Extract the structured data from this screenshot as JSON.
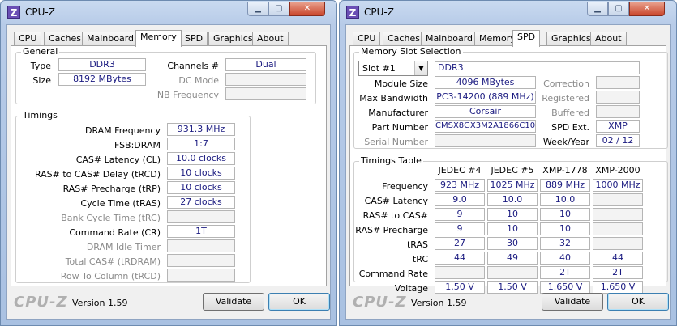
{
  "windows": [
    {
      "title": "CPU-Z",
      "tabs": [
        "CPU",
        "Caches",
        "Mainboard",
        "Memory",
        "SPD",
        "Graphics",
        "About"
      ],
      "active_tab": "Memory",
      "general": {
        "title": "General",
        "type_label": "Type",
        "type_value": "DDR3",
        "size_label": "Size",
        "size_value": "8192 MBytes",
        "channels_label": "Channels #",
        "channels_value": "Dual",
        "dcmode_label": "DC Mode",
        "dcmode_value": "",
        "nbfreq_label": "NB Frequency",
        "nbfreq_value": ""
      },
      "timings": {
        "title": "Timings",
        "rows": [
          {
            "label": "DRAM Frequency",
            "value": "931.3 MHz",
            "disabled": false
          },
          {
            "label": "FSB:DRAM",
            "value": "1:7",
            "disabled": false
          },
          {
            "label": "CAS# Latency (CL)",
            "value": "10.0 clocks",
            "disabled": false
          },
          {
            "label": "RAS# to CAS# Delay (tRCD)",
            "value": "10 clocks",
            "disabled": false
          },
          {
            "label": "RAS# Precharge (tRP)",
            "value": "10 clocks",
            "disabled": false
          },
          {
            "label": "Cycle Time (tRAS)",
            "value": "27 clocks",
            "disabled": false
          },
          {
            "label": "Bank Cycle Time (tRC)",
            "value": "",
            "disabled": true
          },
          {
            "label": "Command Rate (CR)",
            "value": "1T",
            "disabled": false
          },
          {
            "label": "DRAM Idle Timer",
            "value": "",
            "disabled": true
          },
          {
            "label": "Total CAS# (tRDRAM)",
            "value": "",
            "disabled": true
          },
          {
            "label": "Row To Column (tRCD)",
            "value": "",
            "disabled": true
          }
        ]
      },
      "footer": {
        "logo": "CPU-Z",
        "version": "Version 1.59",
        "validate": "Validate",
        "ok": "OK"
      }
    },
    {
      "title": "CPU-Z",
      "tabs": [
        "CPU",
        "Caches",
        "Mainboard",
        "Memory",
        "SPD",
        "Graphics",
        "About"
      ],
      "active_tab": "SPD",
      "slot": {
        "title": "Memory Slot Selection",
        "selected": "Slot #1",
        "type_value": "DDR3",
        "module_size_label": "Module Size",
        "module_size_value": "4096 MBytes",
        "max_bw_label": "Max Bandwidth",
        "max_bw_value": "PC3-14200 (889 MHz)",
        "manufacturer_label": "Manufacturer",
        "manufacturer_value": "Corsair",
        "part_label": "Part Number",
        "part_value": "CMSX8GX3M2A1866C10",
        "serial_label": "Serial Number",
        "serial_value": "",
        "correction_label": "Correction",
        "correction_value": "",
        "registered_label": "Registered",
        "registered_value": "",
        "buffered_label": "Buffered",
        "buffered_value": "",
        "spdext_label": "SPD Ext.",
        "spdext_value": "XMP",
        "weekyear_label": "Week/Year",
        "weekyear_value": "02 / 12"
      },
      "timings_table": {
        "title": "Timings Table",
        "columns": [
          "JEDEC #4",
          "JEDEC #5",
          "XMP-1778",
          "XMP-2000"
        ],
        "rows": [
          {
            "label": "Frequency",
            "values": [
              "923 MHz",
              "1025 MHz",
              "889 MHz",
              "1000 MHz"
            ]
          },
          {
            "label": "CAS# Latency",
            "values": [
              "9.0",
              "10.0",
              "10.0",
              ""
            ]
          },
          {
            "label": "RAS# to CAS#",
            "values": [
              "9",
              "10",
              "10",
              ""
            ]
          },
          {
            "label": "RAS# Precharge",
            "values": [
              "9",
              "10",
              "10",
              ""
            ]
          },
          {
            "label": "tRAS",
            "values": [
              "27",
              "30",
              "32",
              ""
            ]
          },
          {
            "label": "tRC",
            "values": [
              "44",
              "49",
              "40",
              "44"
            ]
          },
          {
            "label": "Command Rate",
            "values": [
              "",
              "",
              "2T",
              "2T"
            ]
          },
          {
            "label": "Voltage",
            "values": [
              "1.50 V",
              "1.50 V",
              "1.650 V",
              "1.650 V"
            ]
          }
        ]
      },
      "footer": {
        "logo": "CPU-Z",
        "version": "Version 1.59",
        "validate": "Validate",
        "ok": "OK"
      }
    }
  ]
}
